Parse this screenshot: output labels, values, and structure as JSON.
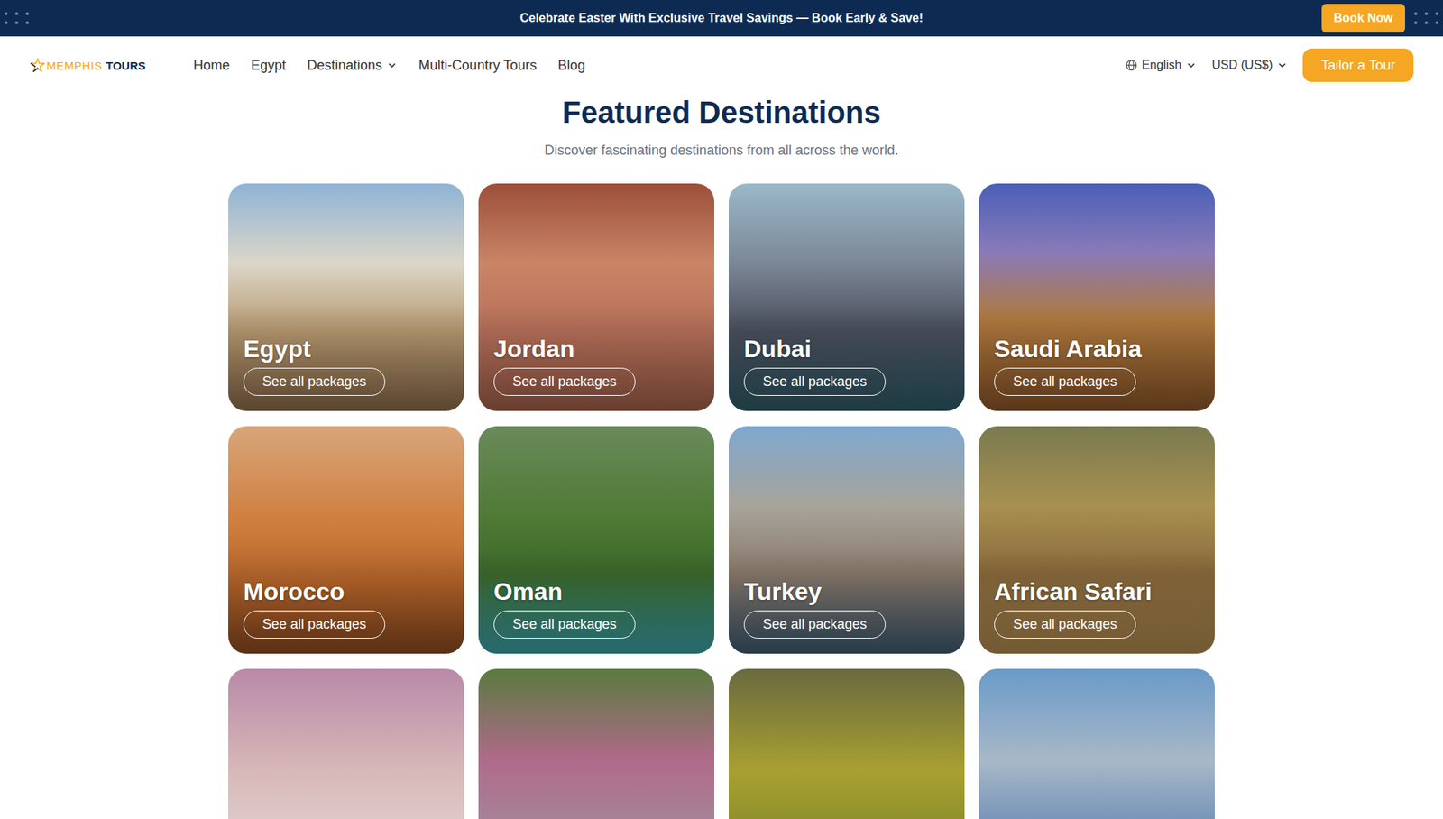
{
  "banner": {
    "text": "Celebrate Easter With Exclusive Travel Savings — Book Early & Save!",
    "button": "Book Now"
  },
  "logo": {
    "brand": "MEMPHIS",
    "suffix": "TOURS"
  },
  "nav": {
    "links": [
      {
        "label": "Home",
        "dropdown": false
      },
      {
        "label": "Egypt",
        "dropdown": false
      },
      {
        "label": "Destinations",
        "dropdown": true
      },
      {
        "label": "Multi-Country Tours",
        "dropdown": false
      },
      {
        "label": "Blog",
        "dropdown": false
      }
    ],
    "language": "English",
    "currency": "USD (US$)",
    "cta": "Tailor a Tour"
  },
  "section": {
    "title": "Featured Destinations",
    "subtitle": "Discover fascinating destinations from all across the world.",
    "cards": [
      {
        "name": "Egypt",
        "button": "See all packages"
      },
      {
        "name": "Jordan",
        "button": "See all packages"
      },
      {
        "name": "Dubai",
        "button": "See all packages"
      },
      {
        "name": "Saudi Arabia",
        "button": "See all packages"
      },
      {
        "name": "Morocco",
        "button": "See all packages"
      },
      {
        "name": "Oman",
        "button": "See all packages"
      },
      {
        "name": "Turkey",
        "button": "See all packages"
      },
      {
        "name": "African Safari",
        "button": "See all packages"
      }
    ]
  }
}
